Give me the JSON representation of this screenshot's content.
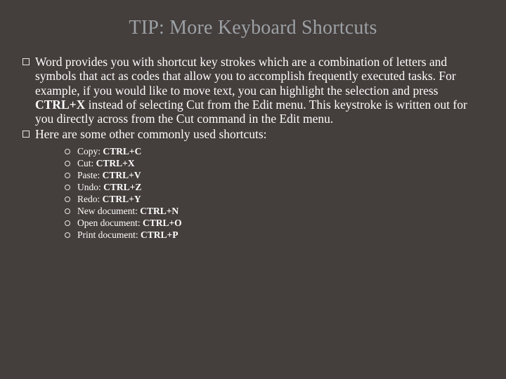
{
  "title": "TIP: More Keyboard Shortcuts",
  "para1_pre": "Word provides you with shortcut key strokes which are a combination of letters and symbols that act as codes that allow you to accomplish frequently executed tasks. For example, if you would like to move text, you can highlight the selection and press ",
  "para1_key": "CTRL+X",
  "para1_post": " instead of selecting Cut from the Edit menu.  This keystroke is written out for you directly across from the Cut command in the Edit menu.",
  "para2": "Here are some other commonly used shortcuts:",
  "shortcuts": [
    {
      "label": "Copy: ",
      "key": "CTRL+C"
    },
    {
      "label": "Cut: ",
      "key": "CTRL+X"
    },
    {
      "label": "Paste: ",
      "key": "CTRL+V"
    },
    {
      "label": "Undo: ",
      "key": "CTRL+Z"
    },
    {
      "label": "Redo: ",
      "key": "CTRL+Y"
    },
    {
      "label": "New document: ",
      "key": "CTRL+N"
    },
    {
      "label": "Open document: ",
      "key": "CTRL+O"
    },
    {
      "label": "Print document: ",
      "key": "CTRL+P"
    }
  ]
}
